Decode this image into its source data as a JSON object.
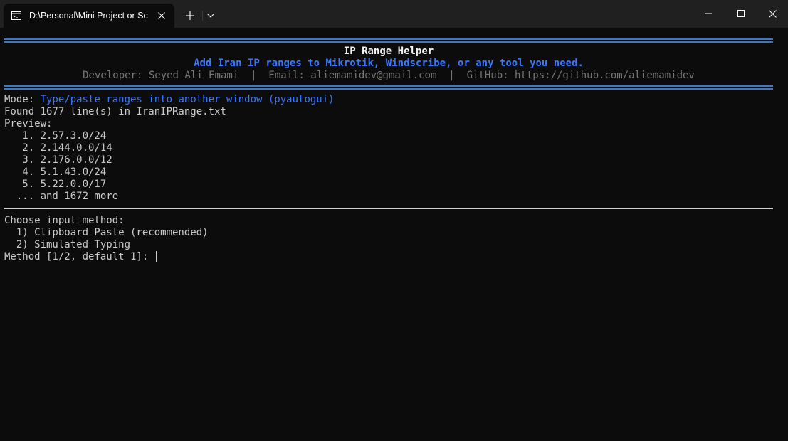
{
  "window": {
    "tab_title": "D:\\Personal\\Mini Project or Sc",
    "icons": {
      "tab": "terminal-icon",
      "tab_close": "close-icon",
      "new_tab": "plus-icon",
      "tab_menu": "chevron-down-icon",
      "minimize": "minimize-icon",
      "maximize": "maximize-icon",
      "close": "close-icon"
    }
  },
  "banner": {
    "title": "IP Range Helper",
    "subtitle": "Add Iran IP ranges to Mikrotik, Windscribe, or any tool you need.",
    "credits": "Developer: Seyed Ali Emami  |  Email: aliemamidev@gmail.com  |  GitHub: https://github.com/aliemamidev"
  },
  "mode": {
    "label": "Mode: ",
    "value": "Type/paste ranges into another window (pyautogui)"
  },
  "found_line": "Found 1677 line(s) in IranIPRange.txt",
  "preview": {
    "label": "Preview:",
    "items": [
      "   1. 2.57.3.0/24",
      "   2. 2.144.0.0/14",
      "   3. 2.176.0.0/12",
      "   4. 5.1.43.0/24",
      "   5. 5.22.0.0/17"
    ],
    "more": "  ... and 1672 more"
  },
  "method": {
    "heading": "Choose input method:",
    "options": [
      "  1) Clipboard Paste (recommended)",
      "  2) Simulated Typing"
    ],
    "prompt": "Method [1/2, default 1]: "
  },
  "colors": {
    "background": "#0c0c0c",
    "text": "#cccccc",
    "accent_blue": "#3b78ff",
    "rule_blue": "#3b78c8",
    "muted_gray": "#767676"
  }
}
